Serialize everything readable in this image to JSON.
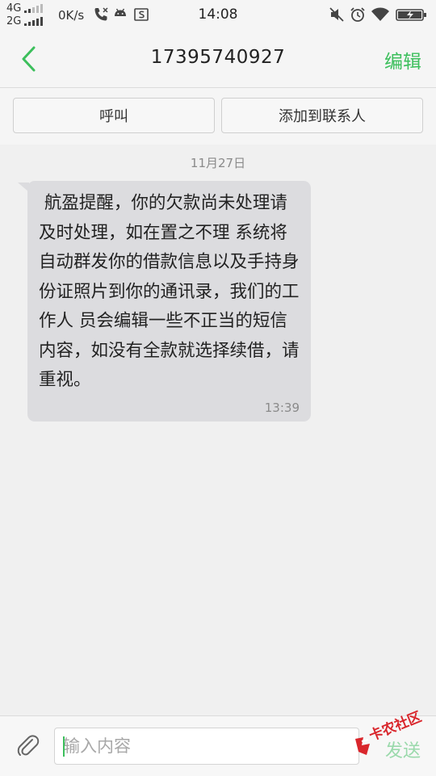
{
  "status_bar": {
    "network_top": "4G",
    "network_bottom": "2G",
    "speed": "0K/s",
    "time": "14:08"
  },
  "header": {
    "title": "17395740927",
    "edit_label": "编辑"
  },
  "actions": {
    "call_label": "呼叫",
    "add_contact_label": "添加到联系人"
  },
  "conversation": {
    "date": "11月27日",
    "message": {
      "text": " 航盈提醒，你的欠款尚未处理请及时处理，如在置之不理 系统将自动群发你的借款信息以及手持身份证照片到你的通讯录，我们的工作人 员会编辑一些不正当的短信内容，如没有全款就选择续借，请重视。",
      "time": "13:39"
    }
  },
  "composer": {
    "placeholder": "输入内容",
    "send_label": "发送"
  },
  "watermark": {
    "text": "卡农社区"
  },
  "colors": {
    "accent": "#3cbf5c",
    "bubble": "#dcdcdf",
    "send_disabled": "#9ad9ab"
  }
}
